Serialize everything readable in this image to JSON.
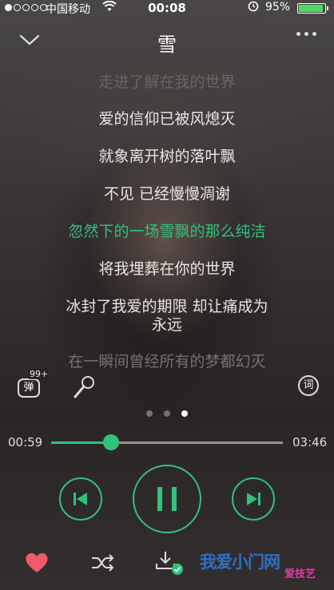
{
  "status": {
    "carrier": "中国移动",
    "time": "00:08",
    "battery_pct": "95%",
    "battery_level": 0.95,
    "signal_dots_filled": 1,
    "signal_dots_total": 5
  },
  "header": {
    "title": "雪"
  },
  "lyrics": {
    "lines": [
      "走进了解在我的世界",
      "爱的信仰已被风熄灭",
      "就象离开树的落叶飘",
      "不见 已经慢慢凋谢",
      "忽然下的一场雪飘的那么纯洁",
      "将我埋葬在你的世界",
      "冰封了我爱的期限 却让痛成为",
      "永远",
      "在一瞬间曾经所有的梦都幻灭"
    ],
    "current_index": 4
  },
  "tools": {
    "danmu_label": "弹",
    "danmu_count": "99+",
    "lyric_label": "词"
  },
  "pager": {
    "pages": 3,
    "active": 2
  },
  "progress": {
    "elapsed": "00:59",
    "total": "03:46",
    "fraction": 0.26
  },
  "colors": {
    "accent": "#31c27c",
    "heart": "#f05a6a",
    "watermark_blue": "#2f7de0",
    "watermark_pink": "#e33aa8"
  },
  "icons": {
    "back": "chevron-down-icon",
    "more": "more-dots-icon",
    "danmu": "danmu-icon",
    "mic": "microphone-icon",
    "lyric": "lyric-icon",
    "prev": "previous-track-icon",
    "pause": "pause-icon",
    "next": "next-track-icon",
    "heart": "heart-icon",
    "shuffle": "shuffle-icon",
    "download": "download-icon"
  },
  "watermark": {
    "text": "我爱小门网",
    "sub": "爱技艺"
  }
}
